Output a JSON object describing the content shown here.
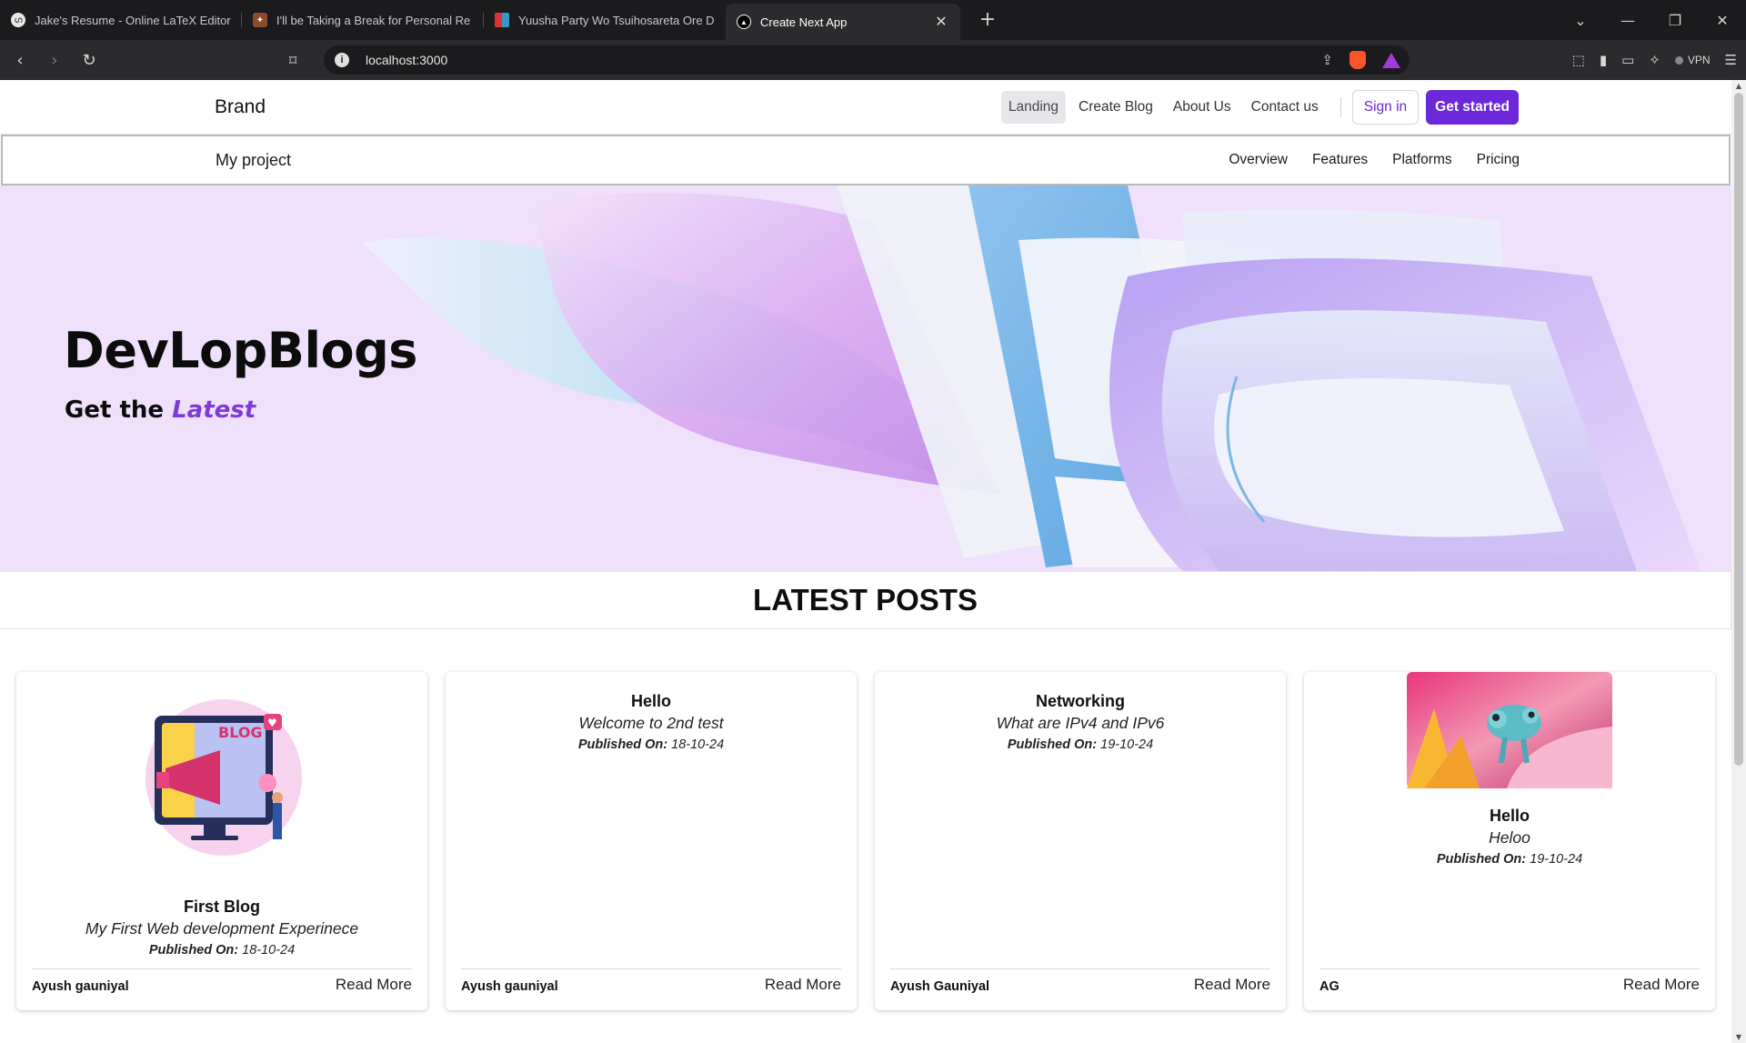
{
  "browser": {
    "tabs": [
      {
        "title": "Jake's Resume - Online LaTeX Editor",
        "favicon": "overleaf-icon",
        "active": false
      },
      {
        "title": "I'll be Taking a Break for Personal Re",
        "favicon": "manga-icon",
        "active": false
      },
      {
        "title": "Yuusha Party Wo Tsuihosareta Ore D",
        "favicon": "manga-logo-icon",
        "active": false
      },
      {
        "title": "Create Next App",
        "favicon": "nextjs-icon",
        "active": true
      }
    ],
    "url": "localhost:3000",
    "vpn_label": "VPN"
  },
  "topnav": {
    "brand": "Brand",
    "links": [
      {
        "label": "Landing",
        "active": true
      },
      {
        "label": "Create Blog",
        "active": false
      },
      {
        "label": "About Us",
        "active": false
      },
      {
        "label": "Contact us",
        "active": false
      }
    ],
    "signin": "Sign in",
    "get_started": "Get started"
  },
  "subnav": {
    "brand": "My project",
    "links": [
      "Overview",
      "Features",
      "Platforms",
      "Pricing"
    ]
  },
  "hero": {
    "title": "DevLopBlogs",
    "sub_prefix": "Get the",
    "sub_emphasis": "Latest"
  },
  "posts": {
    "heading": "LATEST POSTS",
    "published_label": "Published On:",
    "read_more": "Read More",
    "items": [
      {
        "title": "First Blog",
        "desc": "My First Web development Experinece",
        "date": "18-10-24",
        "author": "Ayush gauniyal",
        "image": "blog-illustration"
      },
      {
        "title": "Hello",
        "desc": "Welcome to 2nd test",
        "date": "18-10-24",
        "author": "Ayush gauniyal",
        "image": ""
      },
      {
        "title": "Networking",
        "desc": "What are IPv4 and IPv6",
        "date": "19-10-24",
        "author": "Ayush Gauniyal",
        "image": ""
      },
      {
        "title": "Hello",
        "desc": "Heloo",
        "date": "19-10-24",
        "author": "AG",
        "image": "chameleon-photo"
      }
    ]
  },
  "colors": {
    "accent": "#6d28d9",
    "hero_bg": "#efe1fb",
    "hero_emphasis": "#7c3ad8"
  }
}
